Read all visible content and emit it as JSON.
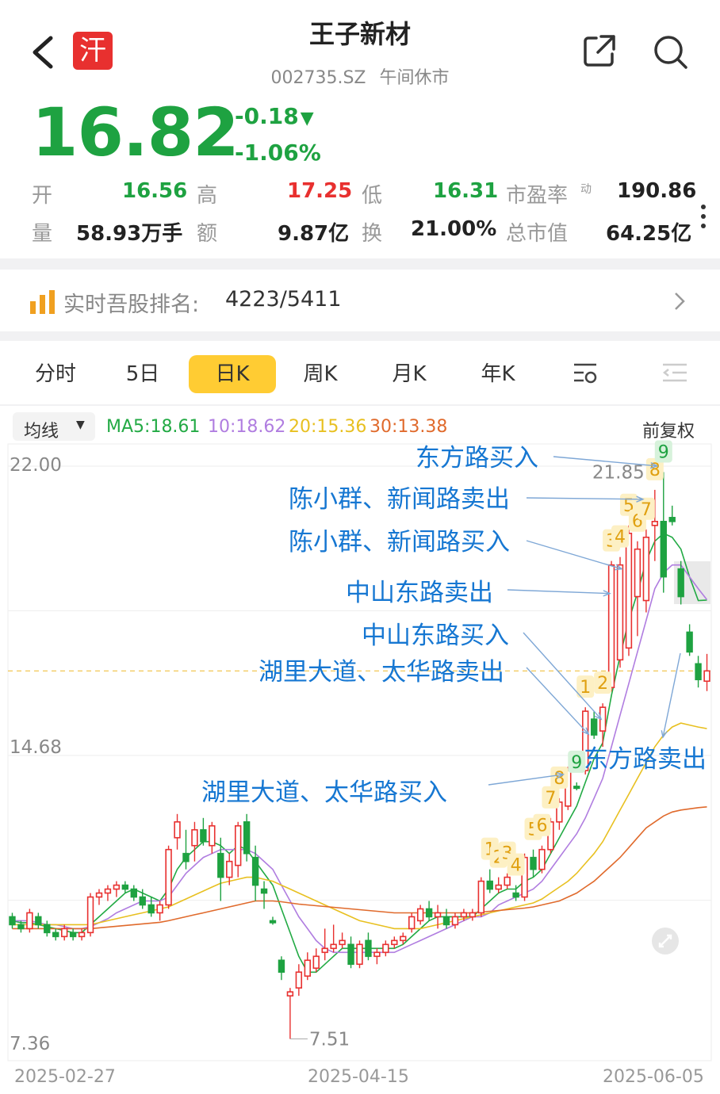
{
  "header": {
    "title": "王子新材",
    "code": "002735.SZ",
    "status": "午间休市",
    "logo_text": "汗"
  },
  "quote": {
    "price": "16.82",
    "change": "-0.18",
    "change_pct": "-1.06%",
    "arrow": "▼",
    "open_label": "开",
    "open": "16.56",
    "high_label": "高",
    "high": "17.25",
    "low_label": "低",
    "low": "16.31",
    "pe_label": "市盈率",
    "pe_sup": "动",
    "pe": "190.86",
    "vol_label": "量",
    "vol": "58.93万手",
    "amt_label": "额",
    "amt": "9.87亿",
    "turn_label": "换",
    "turn": "21.00%",
    "mcap_label": "总市值",
    "mcap": "64.25亿"
  },
  "rank": {
    "label": "实时吾股排名:",
    "value": "4223/5411"
  },
  "tabs": [
    "分时",
    "5日",
    "日K",
    "周K",
    "月K",
    "年K"
  ],
  "active_tab": "日K",
  "chart_toolbar": {
    "ma_selector": "均线",
    "ma5": "MA5:18.61",
    "ma10": "10:18.62",
    "ma20": "20:15.36",
    "ma30": "30:13.38",
    "adjust": "前复权"
  },
  "colors": {
    "up": "#e8302f",
    "down": "#1ea241",
    "ma5": "#22aa44",
    "ma10": "#b07de0",
    "ma20": "#e8c020",
    "ma30": "#e06a2c",
    "annotation": "#1677d2",
    "accent": "#ffcc33"
  },
  "chart_data": {
    "type": "candlestick",
    "y_ticks": [
      "22.00",
      "14.68",
      "7.36"
    ],
    "ylim": [
      7.36,
      22.0
    ],
    "x_labels": [
      "2025-02-27",
      "2025-04-15",
      "2025-06-05"
    ],
    "max_label": "21.85",
    "min_label": "7.51",
    "ref_price": 16.82,
    "candles": [
      [
        10.6,
        10.7,
        10.3,
        10.4
      ],
      [
        10.4,
        10.5,
        10.2,
        10.3
      ],
      [
        10.3,
        10.8,
        10.2,
        10.7
      ],
      [
        10.6,
        10.7,
        10.3,
        10.4
      ],
      [
        10.4,
        10.5,
        10.1,
        10.2
      ],
      [
        10.2,
        10.3,
        10.0,
        10.1
      ],
      [
        10.1,
        10.4,
        10.0,
        10.3
      ],
      [
        10.2,
        10.3,
        10.0,
        10.1
      ],
      [
        10.1,
        10.3,
        10.0,
        10.2
      ],
      [
        10.2,
        11.2,
        10.1,
        11.1
      ],
      [
        11.1,
        11.3,
        10.9,
        11.2
      ],
      [
        11.2,
        11.4,
        11.0,
        11.3
      ],
      [
        11.3,
        11.5,
        11.1,
        11.4
      ],
      [
        11.4,
        11.5,
        11.2,
        11.3
      ],
      [
        11.3,
        11.4,
        11.0,
        11.1
      ],
      [
        11.1,
        11.3,
        10.8,
        10.9
      ],
      [
        10.9,
        11.1,
        10.6,
        10.7
      ],
      [
        10.7,
        11.0,
        10.5,
        10.9
      ],
      [
        10.9,
        12.4,
        10.8,
        12.3
      ],
      [
        12.6,
        13.2,
        12.3,
        13.0
      ],
      [
        12.2,
        12.8,
        11.8,
        12.0
      ],
      [
        12.4,
        13.0,
        12.0,
        12.8
      ],
      [
        12.8,
        13.1,
        12.4,
        12.5
      ],
      [
        12.4,
        13.0,
        12.2,
        12.9
      ],
      [
        12.2,
        12.6,
        11.0,
        11.6
      ],
      [
        11.6,
        12.2,
        11.4,
        12.0
      ],
      [
        11.9,
        13.0,
        11.6,
        12.9
      ],
      [
        13.0,
        13.2,
        12.0,
        12.2
      ],
      [
        12.1,
        12.4,
        11.0,
        11.4
      ],
      [
        11.3,
        11.5,
        10.8,
        11.2
      ],
      [
        10.5,
        10.6,
        10.4,
        10.45
      ],
      [
        9.5,
        9.6,
        9.0,
        9.2
      ],
      [
        8.6,
        8.8,
        7.51,
        8.7
      ],
      [
        8.8,
        9.4,
        8.6,
        9.2
      ],
      [
        9.1,
        9.7,
        9.0,
        9.5
      ],
      [
        9.3,
        9.8,
        9.2,
        9.6
      ],
      [
        9.7,
        10.3,
        9.5,
        9.8
      ],
      [
        9.8,
        10.4,
        9.7,
        9.9
      ],
      [
        9.9,
        10.2,
        9.8,
        10.0
      ],
      [
        9.9,
        10.1,
        9.3,
        9.4
      ],
      [
        9.4,
        10.0,
        9.3,
        9.9
      ],
      [
        10.0,
        10.2,
        9.5,
        9.6
      ],
      [
        9.6,
        9.8,
        9.4,
        9.7
      ],
      [
        9.7,
        10.0,
        9.6,
        9.9
      ],
      [
        9.9,
        10.1,
        9.8,
        10.0
      ],
      [
        10.0,
        10.2,
        9.9,
        10.1
      ],
      [
        10.3,
        10.7,
        10.2,
        10.6
      ],
      [
        10.5,
        10.9,
        10.4,
        10.8
      ],
      [
        10.8,
        11.0,
        10.5,
        10.6
      ],
      [
        10.6,
        10.9,
        10.3,
        10.7
      ],
      [
        10.6,
        10.8,
        10.3,
        10.4
      ],
      [
        10.4,
        10.7,
        10.3,
        10.6
      ],
      [
        10.6,
        10.8,
        10.5,
        10.7
      ],
      [
        10.6,
        10.8,
        10.5,
        10.7
      ],
      [
        10.7,
        11.6,
        10.6,
        11.5
      ],
      [
        11.5,
        11.8,
        11.2,
        11.3
      ],
      [
        11.3,
        11.6,
        11.2,
        11.4
      ],
      [
        11.4,
        11.7,
        11.3,
        11.6
      ],
      [
        11.2,
        11.4,
        11.0,
        11.1
      ],
      [
        11.1,
        12.2,
        11.0,
        12.1
      ],
      [
        12.1,
        12.3,
        11.6,
        11.8
      ],
      [
        11.8,
        12.4,
        11.7,
        12.3
      ],
      [
        12.3,
        13.1,
        12.2,
        13.0
      ],
      [
        13.0,
        13.6,
        12.8,
        13.5
      ],
      [
        13.4,
        14.4,
        13.3,
        14.3
      ],
      [
        13.9,
        14.0,
        13.8,
        13.85
      ],
      [
        14.3,
        15.9,
        14.2,
        15.8
      ],
      [
        15.6,
        15.8,
        15.1,
        15.2
      ],
      [
        15.3,
        16.0,
        14.9,
        15.9
      ],
      [
        16.4,
        19.6,
        16.3,
        19.5
      ],
      [
        17.1,
        19.7,
        16.9,
        19.5
      ],
      [
        17.4,
        20.5,
        17.2,
        20.3
      ],
      [
        18.7,
        20.1,
        17.7,
        19.9
      ],
      [
        18.6,
        20.4,
        18.3,
        20.2
      ],
      [
        20.5,
        21.4,
        19.6,
        20.6
      ],
      [
        20.6,
        21.85,
        18.8,
        19.2
      ],
      [
        20.7,
        21.0,
        20.5,
        20.6
      ],
      [
        19.4,
        19.6,
        18.5,
        18.7
      ],
      [
        17.8,
        18.0,
        17.2,
        17.3
      ],
      [
        17.0,
        17.2,
        16.4,
        16.6
      ],
      [
        16.56,
        17.25,
        16.31,
        16.82
      ]
    ],
    "ma": [
      {
        "name": "MA5",
        "values": [
          10.5,
          10.45,
          10.45,
          10.4,
          10.35,
          10.3,
          10.25,
          10.2,
          10.2,
          10.4,
          10.6,
          10.8,
          11.0,
          11.2,
          11.3,
          11.2,
          11.1,
          11.0,
          11.3,
          11.8,
          12.1,
          12.3,
          12.5,
          12.5,
          12.4,
          12.2,
          12.4,
          12.3,
          12.0,
          11.7,
          11.4,
          10.8,
          10.2,
          9.6,
          9.2,
          9.2,
          9.4,
          9.6,
          9.8,
          9.8,
          9.8,
          9.8,
          9.8,
          9.8,
          9.8,
          9.9,
          10.1,
          10.3,
          10.5,
          10.6,
          10.6,
          10.6,
          10.6,
          10.6,
          10.8,
          11.0,
          11.2,
          11.3,
          11.3,
          11.5,
          11.6,
          11.8,
          12.2,
          12.6,
          13.0,
          13.4,
          14.0,
          14.6,
          15.0,
          16.2,
          17.2,
          18.1,
          18.8,
          19.6,
          20.1,
          20.3,
          20.2,
          19.9,
          19.2,
          18.6,
          18.61
        ]
      },
      {
        "name": "MA10",
        "values": [
          10.5,
          10.5,
          10.5,
          10.45,
          10.4,
          10.4,
          10.35,
          10.3,
          10.3,
          10.35,
          10.45,
          10.55,
          10.7,
          10.8,
          10.9,
          11.0,
          11.0,
          11.0,
          11.1,
          11.4,
          11.7,
          11.9,
          12.1,
          12.2,
          12.3,
          12.3,
          12.3,
          12.3,
          12.2,
          12.0,
          11.8,
          11.4,
          11.0,
          10.6,
          10.3,
          10.0,
          9.8,
          9.7,
          9.7,
          9.7,
          9.7,
          9.7,
          9.7,
          9.7,
          9.7,
          9.8,
          9.9,
          10.0,
          10.1,
          10.2,
          10.3,
          10.4,
          10.5,
          10.6,
          10.6,
          10.7,
          10.9,
          11.0,
          11.1,
          11.2,
          11.3,
          11.5,
          11.8,
          12.1,
          12.4,
          12.7,
          13.1,
          13.6,
          14.1,
          14.9,
          15.7,
          16.5,
          17.3,
          18.1,
          18.9,
          19.3,
          19.5,
          19.5,
          19.2,
          18.9,
          18.62
        ]
      },
      {
        "name": "MA20",
        "values": [
          10.4,
          10.4,
          10.4,
          10.4,
          10.4,
          10.4,
          10.4,
          10.4,
          10.4,
          10.4,
          10.45,
          10.5,
          10.55,
          10.6,
          10.65,
          10.7,
          10.75,
          10.8,
          10.85,
          10.95,
          11.05,
          11.15,
          11.25,
          11.35,
          11.45,
          11.5,
          11.55,
          11.6,
          11.6,
          11.55,
          11.5,
          11.4,
          11.3,
          11.2,
          11.1,
          11.0,
          10.9,
          10.8,
          10.7,
          10.6,
          10.5,
          10.45,
          10.4,
          10.35,
          10.3,
          10.3,
          10.3,
          10.3,
          10.35,
          10.4,
          10.45,
          10.5,
          10.55,
          10.6,
          10.65,
          10.7,
          10.75,
          10.8,
          10.85,
          10.9,
          10.95,
          11.05,
          11.2,
          11.35,
          11.5,
          11.7,
          11.95,
          12.2,
          12.5,
          12.9,
          13.3,
          13.7,
          14.1,
          14.5,
          14.9,
          15.2,
          15.4,
          15.5,
          15.45,
          15.4,
          15.36
        ]
      },
      {
        "name": "MA30",
        "values": [
          10.3,
          10.3,
          10.3,
          10.3,
          10.3,
          10.3,
          10.3,
          10.3,
          10.3,
          10.3,
          10.32,
          10.34,
          10.36,
          10.38,
          10.4,
          10.42,
          10.44,
          10.46,
          10.5,
          10.55,
          10.6,
          10.65,
          10.7,
          10.75,
          10.8,
          10.85,
          10.9,
          10.95,
          11.0,
          11.0,
          11.0,
          10.98,
          10.95,
          10.92,
          10.9,
          10.88,
          10.86,
          10.84,
          10.82,
          10.8,
          10.78,
          10.76,
          10.74,
          10.72,
          10.7,
          10.7,
          10.7,
          10.7,
          10.7,
          10.7,
          10.7,
          10.7,
          10.7,
          10.7,
          10.72,
          10.74,
          10.76,
          10.78,
          10.8,
          10.82,
          10.85,
          10.9,
          10.95,
          11.0,
          11.1,
          11.2,
          11.35,
          11.5,
          11.7,
          11.9,
          12.1,
          12.35,
          12.6,
          12.85,
          13.0,
          13.15,
          13.25,
          13.3,
          13.33,
          13.36,
          13.38
        ]
      }
    ],
    "markers": [
      {
        "i": 55,
        "label": "1",
        "c": "y"
      },
      {
        "i": 56,
        "label": "2",
        "c": "y"
      },
      {
        "i": 57,
        "label": "3",
        "c": "y"
      },
      {
        "i": 58,
        "label": "4",
        "c": "y"
      },
      {
        "i": 60,
        "label": "5",
        "c": "y"
      },
      {
        "i": 61,
        "label": "6",
        "c": "y"
      },
      {
        "i": 62,
        "label": "7",
        "c": "y"
      },
      {
        "i": 63,
        "label": "8",
        "c": "y"
      },
      {
        "i": 65,
        "label": "9",
        "c": "g"
      },
      {
        "i": 66,
        "label": "1",
        "c": "y"
      },
      {
        "i": 68,
        "label": "2",
        "c": "y"
      },
      {
        "i": 69,
        "label": "3",
        "c": "y"
      },
      {
        "i": 70,
        "label": "4",
        "c": "y"
      },
      {
        "i": 71,
        "label": "5",
        "c": "y"
      },
      {
        "i": 72,
        "label": "6",
        "c": "y"
      },
      {
        "i": 73,
        "label": "7",
        "c": "y"
      },
      {
        "i": 74,
        "label": "8",
        "c": "y"
      },
      {
        "i": 75,
        "label": "9",
        "c": "g"
      }
    ],
    "annotations": [
      "东方路买入",
      "陈小群、新闻路卖出",
      "陈小群、新闻路买入",
      "中山东路卖出",
      "中山东路买入",
      "湖里大道、太华路卖出",
      "湖里大道、太华路买入",
      "东方路卖出"
    ]
  }
}
